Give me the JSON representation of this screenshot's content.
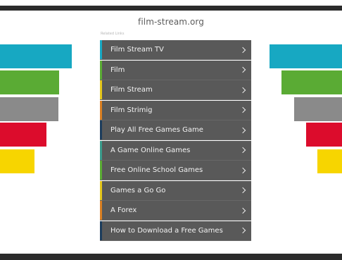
{
  "header": {
    "site_title": "film-stream.org",
    "related_label": "Related Links"
  },
  "theme": {
    "list_bg": "#595959",
    "stair_colors": [
      "#17a8c2",
      "#5aab34",
      "#8a8a8a",
      "#dc0c2c",
      "#f7d500"
    ],
    "accent_colors": [
      "#17a8c2",
      "#5aab34",
      "#e3c51a",
      "#d97f22",
      "#1d3d5c",
      "#3a9a8a",
      "#5aab34",
      "#e3c51a",
      "#d97f22",
      "#1d3d5c"
    ]
  },
  "links": [
    {
      "label": "Film Stream TV",
      "icon": "chevron-right-icon"
    },
    {
      "label": "Film",
      "icon": "chevron-right-icon"
    },
    {
      "label": "Film Stream",
      "icon": "chevron-right-icon"
    },
    {
      "label": "Film Strimig",
      "icon": "chevron-right-icon"
    },
    {
      "label": "Play All Free Games Game",
      "icon": "chevron-right-icon"
    },
    {
      "label": "A Game Online Games",
      "icon": "chevron-right-icon"
    },
    {
      "label": "Free Online School Games",
      "icon": "chevron-right-icon"
    },
    {
      "label": "Games a Go Go",
      "icon": "chevron-right-icon"
    },
    {
      "label": "A Forex",
      "icon": "chevron-right-icon"
    },
    {
      "label": "How to Download a Free Games",
      "icon": "chevron-right-icon"
    }
  ]
}
